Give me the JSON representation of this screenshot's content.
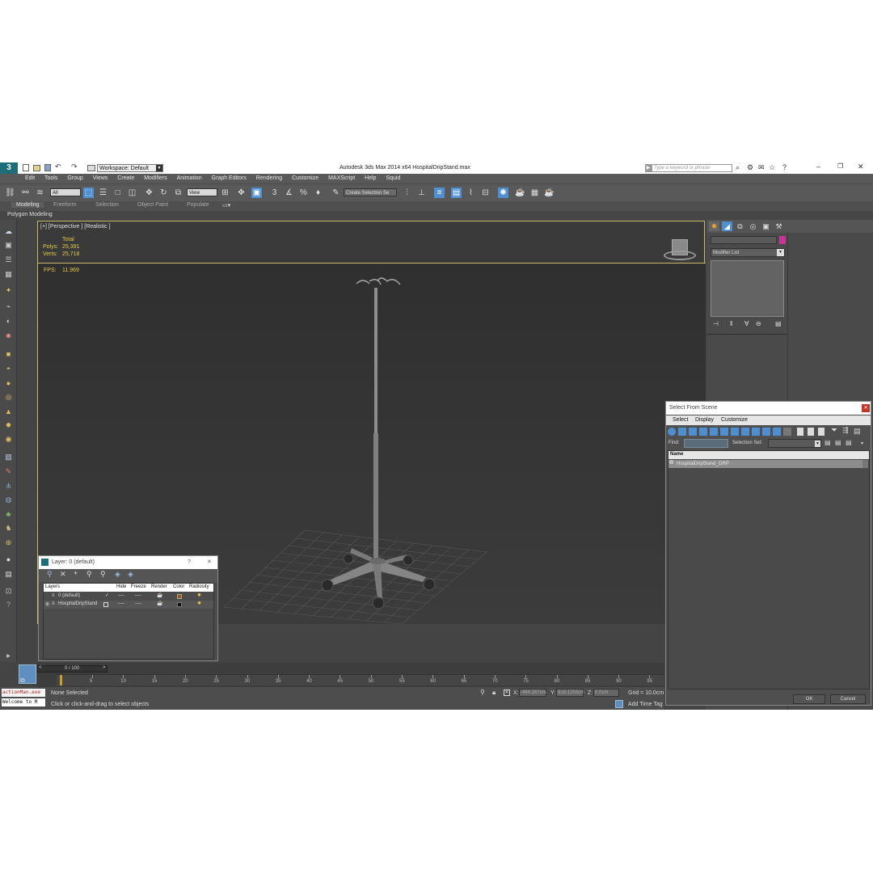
{
  "titlebar": {
    "workspace": "Workspace: Default",
    "title": "Autodesk 3ds Max  2014 x64     HospitalDripStand.max",
    "search_placeholder": "Type a keyword or phrase"
  },
  "menu": [
    "Edit",
    "Tools",
    "Group",
    "Views",
    "Create",
    "Modifiers",
    "Animation",
    "Graph Editors",
    "Rendering",
    "Customize",
    "MAXScript",
    "Help",
    "Squid"
  ],
  "toolbar": {
    "filter": "All",
    "coord": "View",
    "selection_set": "Create Selection Se"
  },
  "ribbon": {
    "tabs": [
      "Modeling",
      "Freeform",
      "Selection",
      "Object Paint",
      "Populate"
    ],
    "sub": "Polygon Modeling"
  },
  "viewport": {
    "label": "[+] [Perspective ] [Realistic ]",
    "stats": {
      "total_label": "Total",
      "polys_label": "Polys:",
      "polys": "25,391",
      "verts_label": "Verts:",
      "verts": "25,718",
      "fps_label": "FPS:",
      "fps": "11.969"
    }
  },
  "command_panel": {
    "modifier_list": "Modifier List"
  },
  "layer_dialog": {
    "title": "Layer: 0 (default)",
    "help": "?",
    "close": "✕",
    "columns": [
      "Layers",
      "Hide",
      "Freeze",
      "Render",
      "Color",
      "Radiosity"
    ],
    "rows": [
      {
        "name": "0 (default)",
        "hide": "✓",
        "freeze": "----",
        "render": "----",
        "color": "#a0522d"
      },
      {
        "name": "HospitalDripStand",
        "hide": "",
        "freeze": "----",
        "render": "----",
        "color": "#111111"
      }
    ]
  },
  "select_dialog": {
    "title": "Select From Scene",
    "menu": [
      "Select",
      "Display",
      "Customize"
    ],
    "find_label": "Find:",
    "selection_set_label": "Selection Set:",
    "column": "Name",
    "item": "HospitalDripStand_GRP",
    "ok": "OK",
    "cancel": "Cancel"
  },
  "timeline": {
    "frame": "0 / 100",
    "ticks": [
      "5",
      "10",
      "15",
      "20",
      "25",
      "30",
      "35",
      "40",
      "45",
      "50",
      "55",
      "60",
      "65",
      "70",
      "75",
      "80",
      "85",
      "90",
      "95"
    ]
  },
  "status": {
    "script_label": "actionMan.exe",
    "welcome": "Welcome to M",
    "none_selected": "None Selected",
    "hint": "Click or click-and-drag to select objects",
    "x_label": "X:",
    "x": "-484.267cm",
    "y_label": "Y:",
    "y": "918.1255cm",
    "z_label": "Z:",
    "z": "0.0cm",
    "grid": "Grid = 10.0cm",
    "add_time_tag": "Add Time Tag"
  }
}
